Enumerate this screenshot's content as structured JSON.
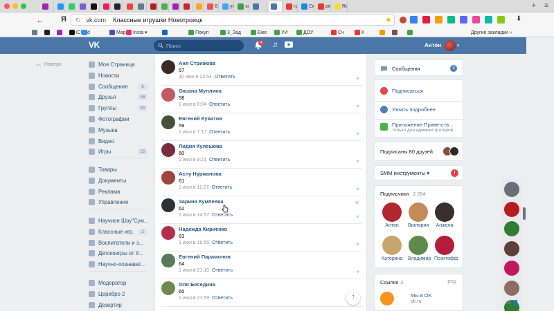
{
  "browser": {
    "tabs": [
      {
        "label": "",
        "color": "#9c27b0"
      },
      {
        "label": "",
        "color": "#2196f3"
      },
      {
        "label": "",
        "color": "#25d366"
      },
      {
        "label": "",
        "color": "#7b5cd6"
      },
      {
        "label": "",
        "color": "#111111"
      },
      {
        "label": "",
        "color": "#e91e63"
      },
      {
        "label": "",
        "color": "#222222"
      },
      {
        "label": "",
        "color": "#f44336"
      },
      {
        "label": "",
        "color": "#607d8b"
      },
      {
        "label": "",
        "color": "#b71c1c"
      },
      {
        "label": "",
        "color": "#4caf50"
      },
      {
        "label": "",
        "color": "#9c27b0"
      },
      {
        "label": "",
        "color": "#c62828"
      },
      {
        "label": "",
        "color": "#f9a825"
      },
      {
        "label": "61",
        "color": "#ef5350"
      },
      {
        "label": "ук",
        "color": "#42a5f5"
      },
      {
        "label": "за",
        "color": "#43a047"
      },
      {
        "label": "",
        "color": "#4a76a8"
      },
      {
        "label": "",
        "color": "#4a76a8"
      },
      {
        "label": "гр",
        "color": "#e53935"
      },
      {
        "label": "Ск",
        "color": "#1e88e5"
      },
      {
        "label": "ре",
        "color": "#e53935"
      },
      {
        "label": "Ro",
        "color": "#fdd835"
      }
    ],
    "nav": {
      "back": "←",
      "forward": "→",
      "reload": "↻",
      "y": "Я"
    },
    "address": {
      "domain": "vk.com",
      "title": "Классные игрушки Новотроицк"
    },
    "bookmarks": [
      "",
      "",
      "",
      "iCloud",
      "",
      "Марк",
      "Insta ▾",
      "",
      "Покуп",
      "3_Зад",
      "Еже",
      "УИ",
      "ДОУ",
      "Сч",
      "К",
      "",
      "",
      ""
    ],
    "other_bookmarks": "Другие закладки"
  },
  "vk": {
    "header": {
      "logo": "VK",
      "search_placeholder": "Поиск",
      "notifications": "4",
      "username": "Антон"
    },
    "back_link": "Наверх",
    "nav": [
      {
        "label": "Моя Страница",
        "count": ""
      },
      {
        "label": "Новости",
        "count": ""
      },
      {
        "label": "Сообщения",
        "count": "6"
      },
      {
        "label": "Друзья",
        "count": "38"
      },
      {
        "label": "Группы",
        "count": "90"
      },
      {
        "label": "Фотографии",
        "count": ""
      },
      {
        "label": "Музыка",
        "count": ""
      },
      {
        "label": "Видео",
        "count": ""
      },
      {
        "label": "Игры",
        "count": "25"
      }
    ],
    "nav2": [
      {
        "label": "Товары",
        "count": ""
      },
      {
        "label": "Документы",
        "count": ""
      },
      {
        "label": "Реклама",
        "count": ""
      },
      {
        "label": "Управление",
        "count": ""
      }
    ],
    "nav3": [
      {
        "label": "Научное Шоу\"Сум...",
        "count": ""
      },
      {
        "label": "Классные игр...",
        "count": "2"
      },
      {
        "label": "Воспитатели и з...",
        "count": ""
      },
      {
        "label": "Детскоигры от У...",
        "count": ""
      },
      {
        "label": "Научно-познават...",
        "count": ""
      }
    ],
    "nav4": [
      {
        "label": "Модератор",
        "count": ""
      },
      {
        "label": "Церебро 2",
        "count": ""
      },
      {
        "label": "Дезертир",
        "count": ""
      }
    ],
    "comments": [
      {
        "name": "Аня Стрижова",
        "text": "57",
        "date": "30 июн в 23:54",
        "reply": "Ответить",
        "color": "#3a2a22"
      },
      {
        "name": "Оксана Муллина",
        "text": "58",
        "date": "1 июл в 0:04",
        "reply": "Ответить",
        "color": "#c45a63"
      },
      {
        "name": "Евгений Куватов",
        "text": "59",
        "date": "1 июл в 7:17",
        "reply": "Ответить",
        "color": "#4a4f3a"
      },
      {
        "name": "Лидия Кулешова",
        "text": "60",
        "date": "1 июл в 9:21",
        "reply": "Ответить",
        "color": "#7b2b3c"
      },
      {
        "name": "Аслу Нуржанова",
        "text": "61",
        "date": "1 июл в 11:27",
        "reply": "Ответить",
        "color": "#a0453c"
      },
      {
        "name": "Зарина Кумпеева",
        "text": "62",
        "date": "1 июл в 14:57",
        "reply": "Ответить",
        "color": "#2f3135"
      },
      {
        "name": "Надежда Кириенко",
        "text": "63",
        "date": "1 июл в 19:55",
        "reply": "Ответить",
        "color": "#b0304a"
      },
      {
        "name": "Евгений Парамонов",
        "text": "64",
        "date": "1 июл в 21:10",
        "reply": "Ответить",
        "color": "#557a55"
      },
      {
        "name": "Оля Беседина",
        "text": "65",
        "date": "1 июл в 21:59",
        "reply": "Ответить",
        "color": "#6d8a4f"
      }
    ],
    "right": {
      "messages": {
        "label": "Сообщения",
        "count": "2"
      },
      "subscribe": "Подписаться",
      "learn_more": "Узнать подробнее",
      "app": {
        "title": "Приложение Приветств...",
        "subtitle": "только для администраторов"
      },
      "friends_subscribed": "Подписаны 80 друзей",
      "smm": "SMM инструменты ▾",
      "subscribers": {
        "title": "Подписчики",
        "count": "2 284",
        "people": [
          {
            "name": "Антон",
            "color": "#b3262d"
          },
          {
            "name": "Виктория",
            "color": "#c58a5a"
          },
          {
            "name": "Анжела",
            "color": "#3a2f2e"
          },
          {
            "name": "Катерина",
            "color": "#c9a56e"
          },
          {
            "name": "Владимир",
            "color": "#5e8a4c"
          },
          {
            "name": "Позитифф",
            "color": "#b71c3c"
          }
        ]
      },
      "links": {
        "title": "Ссылки",
        "count": "3",
        "edit": "ред.",
        "item_title": "Мы в ОК",
        "item_url": "ok.ru"
      }
    },
    "chat": {
      "online_count": "64"
    }
  }
}
